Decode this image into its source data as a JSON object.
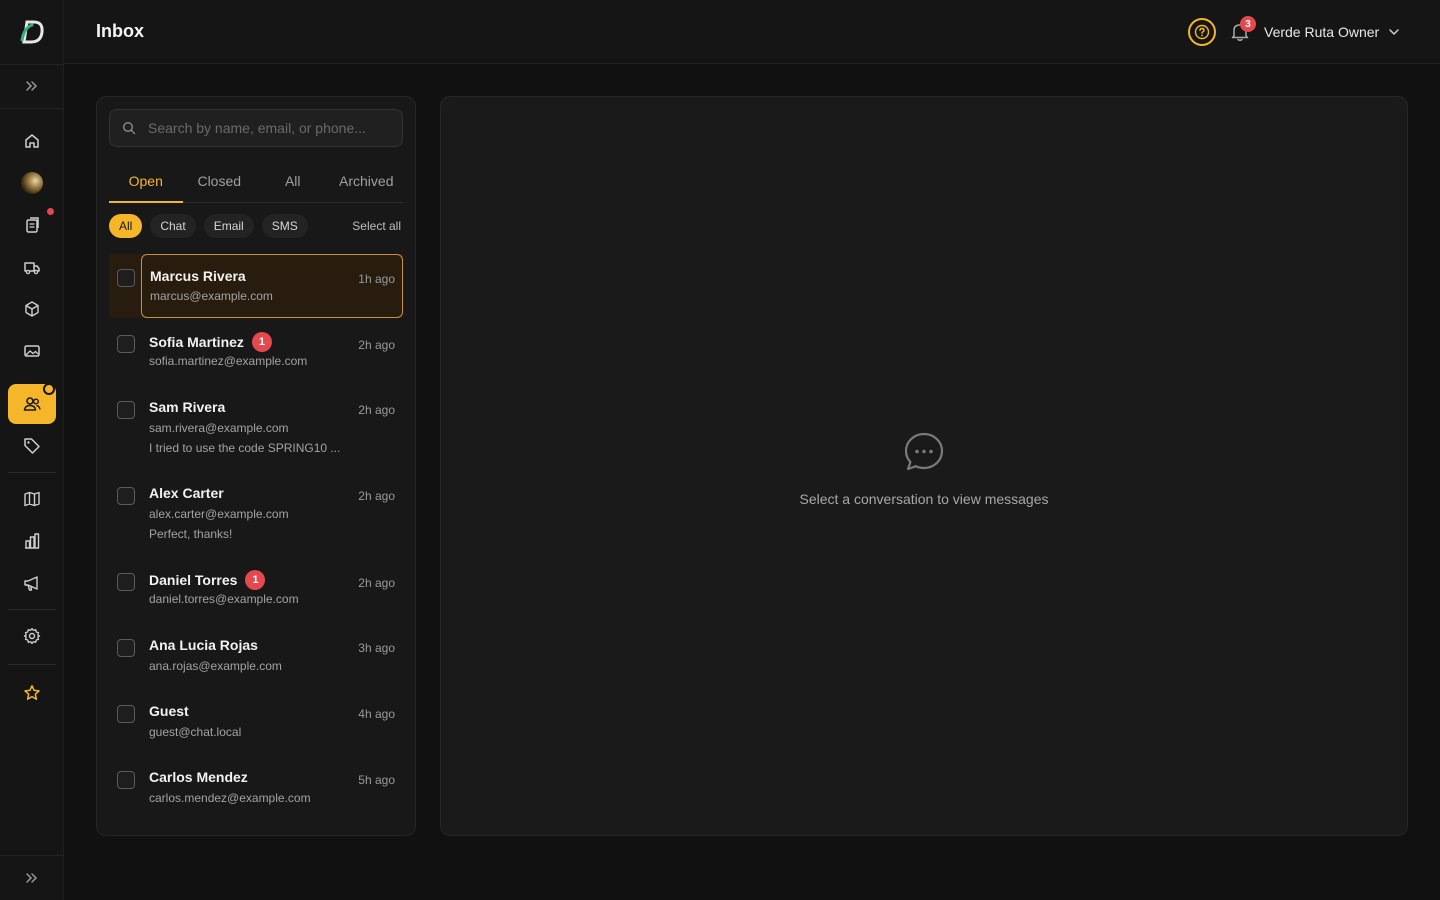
{
  "app": {
    "page_title": "Inbox"
  },
  "header": {
    "notification_count": "3",
    "user_name": "Verde Ruta Owner"
  },
  "search": {
    "placeholder": "Search by name, email, or phone..."
  },
  "tabs": [
    {
      "label": "Open",
      "active": true
    },
    {
      "label": "Closed",
      "active": false
    },
    {
      "label": "All",
      "active": false
    },
    {
      "label": "Archived",
      "active": false
    }
  ],
  "channels": [
    {
      "label": "All",
      "active": true
    },
    {
      "label": "Chat",
      "active": false
    },
    {
      "label": "Email",
      "active": false
    },
    {
      "label": "SMS",
      "active": false
    }
  ],
  "select_all_label": "Select all",
  "conversations": [
    {
      "name": "Marcus Rivera",
      "email": "marcus@example.com",
      "time": "1h ago",
      "unread": "",
      "preview": "",
      "selected": true
    },
    {
      "name": "Sofia Martinez",
      "email": "sofia.martinez@example.com",
      "time": "2h ago",
      "unread": "1",
      "preview": ""
    },
    {
      "name": "Sam Rivera",
      "email": "sam.rivera@example.com",
      "time": "2h ago",
      "unread": "",
      "preview": "I tried to use the code SPRING10 ..."
    },
    {
      "name": "Alex Carter",
      "email": "alex.carter@example.com",
      "time": "2h ago",
      "unread": "",
      "preview": "Perfect, thanks!"
    },
    {
      "name": "Daniel Torres",
      "email": "daniel.torres@example.com",
      "time": "2h ago",
      "unread": "1",
      "preview": ""
    },
    {
      "name": "Ana Lucia Rojas",
      "email": "ana.rojas@example.com",
      "time": "3h ago",
      "unread": "",
      "preview": ""
    },
    {
      "name": "Guest",
      "email": "guest@chat.local",
      "time": "4h ago",
      "unread": "",
      "preview": ""
    },
    {
      "name": "Carlos Mendez",
      "email": "carlos.mendez@example.com",
      "time": "5h ago",
      "unread": "",
      "preview": ""
    }
  ],
  "empty_state": {
    "message": "Select a conversation to view messages",
    "icon": "chat-bubble-icon"
  },
  "sidebar": {
    "items": [
      {
        "icon": "home-icon"
      },
      {
        "icon": "store-avatar"
      },
      {
        "icon": "orders-icon",
        "notification": true
      },
      {
        "icon": "delivery-truck-icon"
      },
      {
        "icon": "package-icon"
      },
      {
        "icon": "image-icon"
      },
      {
        "icon": "customers-icon",
        "active": true
      },
      {
        "icon": "tag-icon"
      },
      {
        "icon": "map-icon"
      },
      {
        "icon": "analytics-icon"
      },
      {
        "icon": "megaphone-icon"
      },
      {
        "icon": "settings-icon"
      },
      {
        "icon": "star-icon"
      }
    ]
  },
  "colors": {
    "accent": "#f5b62a",
    "badge": "#e5484d",
    "background": "#111111",
    "panel": "#181818"
  }
}
